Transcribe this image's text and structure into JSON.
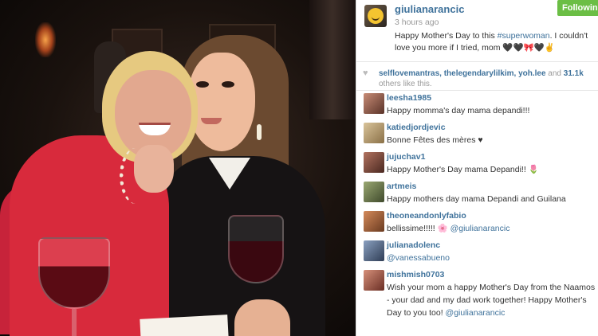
{
  "post": {
    "username": "giulianarancic",
    "time": "3 hours ago",
    "follow_label": "Following",
    "caption_before": "Happy Mother's Day to this ",
    "caption_hashtag": "#superwoman",
    "caption_after": ". I couldn't love you more if I tried, mom 🖤🖤🎀🖤✌",
    "likes_users": "selflovemantras, thelegendarylilkim, yoh.lee",
    "likes_and": " and ",
    "likes_count": "31.1k",
    "likes_suffix": " others like this."
  },
  "comments": [
    {
      "user": "leesha1985",
      "text": "Happy momma's day mama depandi!!!",
      "avatar_color": "#8a5a4a"
    },
    {
      "user": "katiedjordjevic",
      "text": "Bonne Fêtes des mères ♥",
      "avatar_color": "#c9b28a"
    },
    {
      "user": "jujuchav1",
      "text": "Happy Mother's Day mama Depandi!! 🌷",
      "avatar_color": "#7a4a3c"
    },
    {
      "user": "artmeis",
      "text": "Happy mothers day mama Depandi and Guilana",
      "avatar_color": "#6b7a50"
    },
    {
      "user": "theoneandonlyfabio",
      "text": "bellissime!!!!! 🌸 ",
      "mention": "@giulianarancic",
      "avatar_color": "#a0522d"
    },
    {
      "user": "julianadolenc",
      "text": "",
      "mention": "@vanessabueno",
      "avatar_color": "#5a6d86"
    },
    {
      "user": "mishmish0703",
      "text": "Wish your mom a happy Mother's Day from the Naamos - your dad and my dad work together! Happy Mother's Day to you too! ",
      "mention": "@giulianarancic",
      "avatar_color": "#b36a52"
    }
  ],
  "colors": {
    "link_blue": "#3f729b",
    "follow_green": "#6bbe45"
  },
  "icons": {
    "like": "heart-icon"
  }
}
